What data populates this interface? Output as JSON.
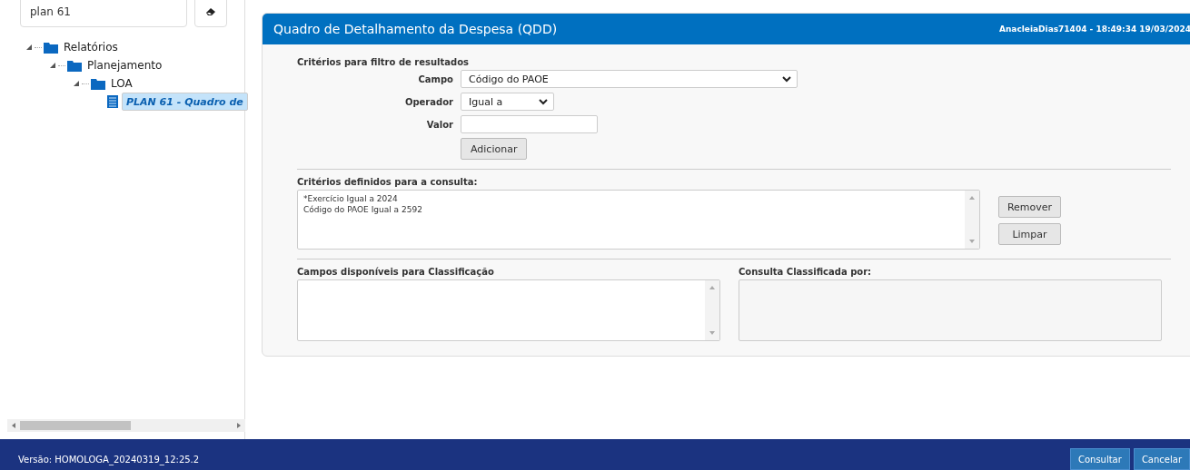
{
  "sidebar": {
    "search": {
      "value": "plan 61"
    },
    "tree": [
      {
        "label": "Relatórios",
        "kind": "folder",
        "expanded": true,
        "selected": false,
        "children": [
          {
            "label": "Planejamento",
            "kind": "folder",
            "expanded": true,
            "selected": false,
            "children": [
              {
                "label": "LOA",
                "kind": "folder",
                "expanded": true,
                "selected": false,
                "children": [
                  {
                    "label": "PLAN 61 - Quadro de",
                    "kind": "report",
                    "selected": true
                  }
                ]
              }
            ]
          }
        ]
      }
    ]
  },
  "panel": {
    "title": "Quadro de Detalhamento da Despesa (QDD)",
    "user_info": "AnacleiaDias71404 - 18:49:34 19/03/2024",
    "filter": {
      "heading": "Critérios para filtro de resultados",
      "fields": [
        {
          "label": "Campo",
          "kind": "select",
          "value": "Código do PAOE"
        },
        {
          "label": "Operador",
          "kind": "select",
          "value": "Igual a"
        },
        {
          "label": "Valor",
          "kind": "input"
        }
      ],
      "add_button": "Adicionar"
    },
    "criteria": {
      "heading": "Critérios definidos para a consulta:",
      "lines": [
        "*Exercício Igual a 2024",
        "Código do PAOE Igual a 2592"
      ],
      "buttons": [
        "Remover",
        "Limpar"
      ]
    },
    "available": {
      "heading": "Campos disponíveis para Classificação"
    },
    "sorted_by": {
      "heading": "Consulta Classificada por:"
    }
  },
  "footer": {
    "version": "Versão: HOMOLOGA_20240319_12:25.2",
    "buttons": [
      "Consultar",
      "Cancelar"
    ]
  }
}
